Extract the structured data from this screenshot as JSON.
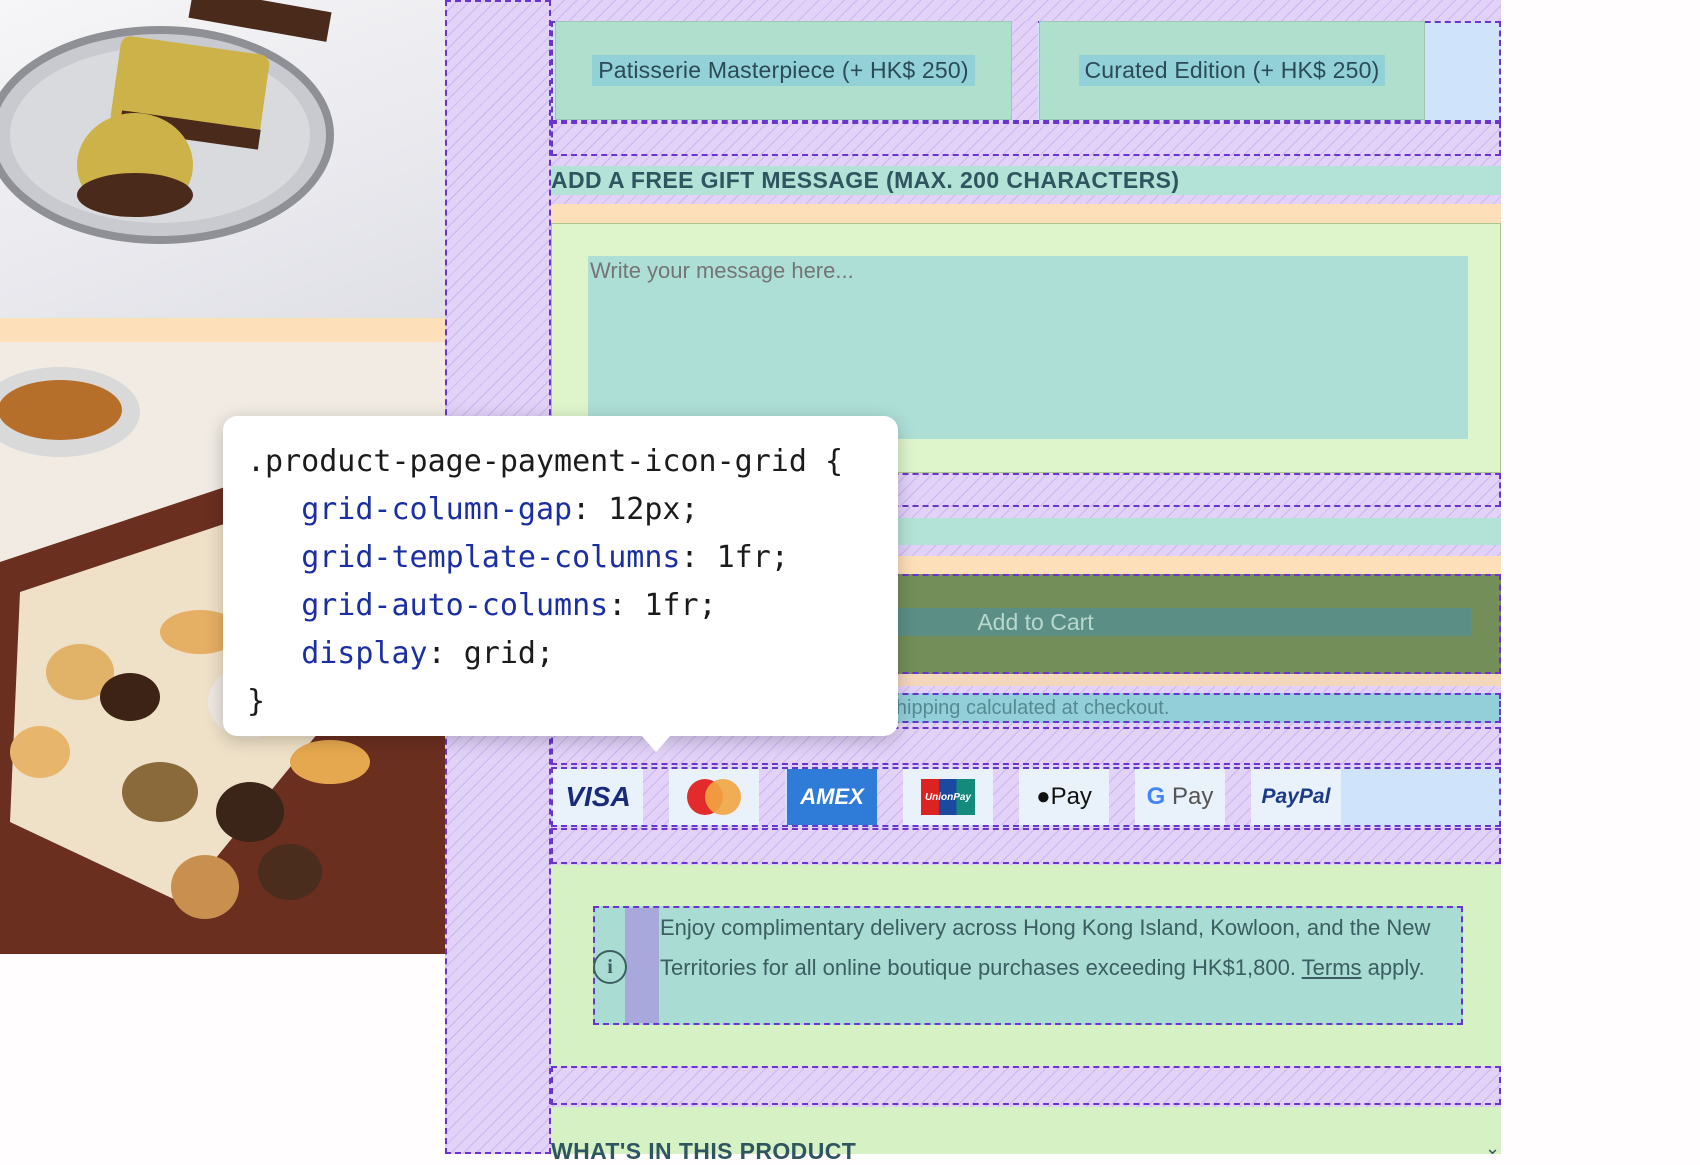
{
  "variants": [
    {
      "label": "Patisserie Masterpiece (+ HK$ 250)"
    },
    {
      "label": "Curated Edition (+ HK$ 250)"
    }
  ],
  "gift": {
    "label": "ADD A FREE GIFT MESSAGE (MAX. 200 CHARACTERS)",
    "placeholder": "Write your message here..."
  },
  "cart": {
    "button_label": "Add to Cart",
    "shipping_note": "Shipping calculated at checkout."
  },
  "payment_icons": [
    "visa-icon",
    "mastercard-icon",
    "amex-icon",
    "unionpay-icon",
    "apple-pay-icon",
    "google-pay-icon",
    "paypal-icon"
  ],
  "payment_labels": {
    "visa": "VISA",
    "amex": "AMEX",
    "unionpay": "UnionPay",
    "applepay": "Pay",
    "gpay": "Pay",
    "paypal": "PayPal"
  },
  "info": {
    "text": "Enjoy complimentary delivery across Hong Kong Island, Kowloon, and the New Territories for all online boutique purchases exceeding HK$1,800.",
    "link": "Terms",
    "suffix": " apply."
  },
  "accordion": {
    "title": "WHAT'S IN THIS PRODUCT"
  },
  "tooltip": {
    "selector": ".product-page-payment-icon-grid {",
    "rules": [
      {
        "prop": "grid-column-gap",
        "value": " 12px;"
      },
      {
        "prop": "grid-template-columns",
        "value": " 1fr;"
      },
      {
        "prop": "grid-auto-columns",
        "value": " 1fr;"
      },
      {
        "prop": "display",
        "value": " grid;"
      }
    ],
    "close": "}"
  },
  "colors": {
    "overlay_purple": "#e2d2f8",
    "margin_peach": "#fde0b9",
    "content_teal": "#b3e3d6",
    "padding_green": "#def5cc",
    "flex_blue": "#cfe3fb"
  }
}
